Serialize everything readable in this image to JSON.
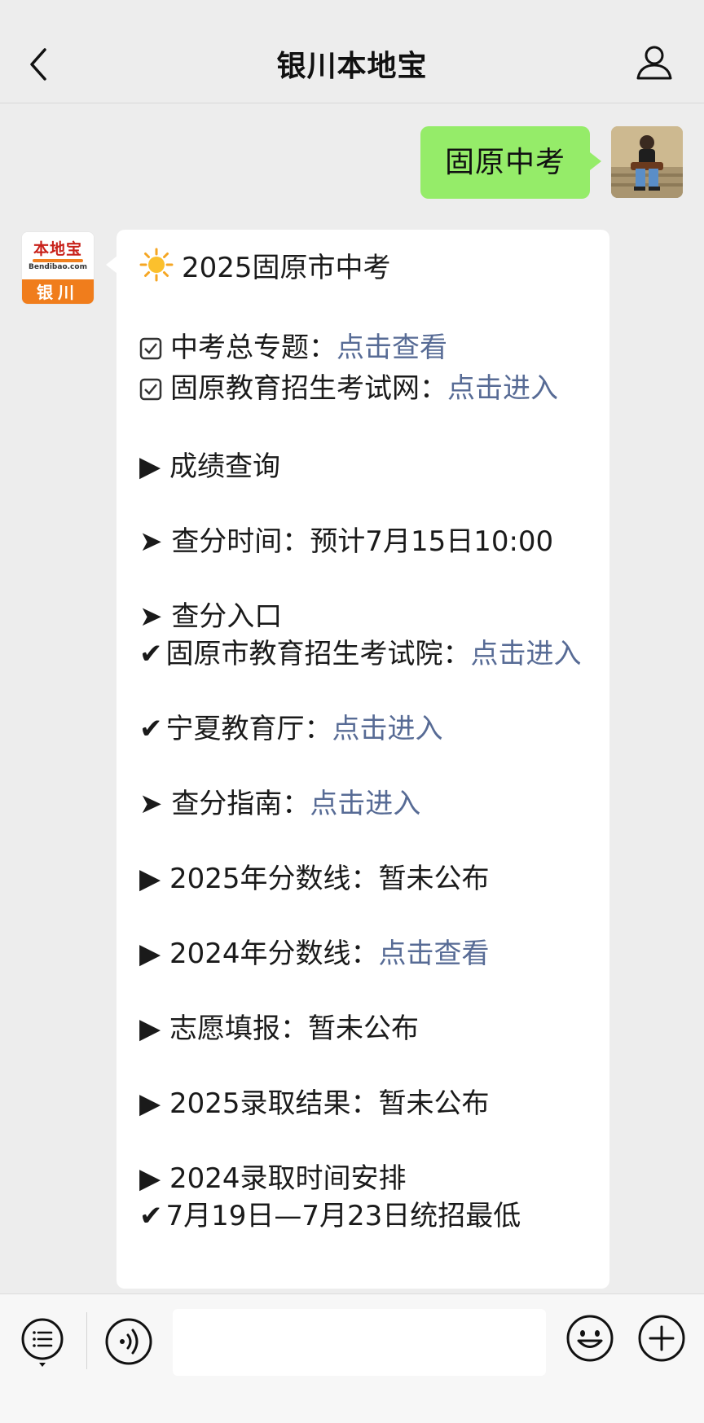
{
  "header": {
    "title": "银川本地宝"
  },
  "outgoing": {
    "text": "固原中考"
  },
  "bot": {
    "logo_brand": "本地宝",
    "logo_site": "Bendibao.com",
    "logo_city": "银川"
  },
  "message": {
    "title": "2025固原市中考",
    "topic_label": "中考总专题：",
    "topic_link": "点击查看",
    "exam_site_label": "固原教育招生考试网：",
    "exam_site_link": "点击进入",
    "score_query": "成绩查询",
    "score_time_label": "查分时间：",
    "score_time_value": "预计7月15日10:00",
    "entry_label": "查分入口",
    "entry1_label": "固原市教育招生考试院：",
    "entry1_link": "点击进入",
    "entry2_label": "宁夏教育厅：",
    "entry2_link": "点击进入",
    "guide_label": "查分指南：",
    "guide_link": "点击进入",
    "line2025_label": "2025年分数线：",
    "line2025_value": "暂未公布",
    "line2024_label": "2024年分数线：",
    "line2024_link": "点击查看",
    "volunteer_label": "志愿填报：",
    "volunteer_value": "暂未公布",
    "result2025_label": "2025录取结果：",
    "result2025_value": "暂未公布",
    "schedule2024_label": "2024录取时间安排",
    "schedule_item": "7月19日—7月23日统招最低"
  },
  "input": {
    "placeholder": ""
  },
  "icons": {
    "back": "chevron-left-icon",
    "profile": "person-icon",
    "menu": "menu-list-icon",
    "voice": "voice-icon",
    "emoji": "emoji-icon",
    "plus": "plus-icon"
  },
  "colors": {
    "outgoing_bubble": "#95ec69",
    "link": "#576b95",
    "logo_orange": "#f07d1c"
  }
}
